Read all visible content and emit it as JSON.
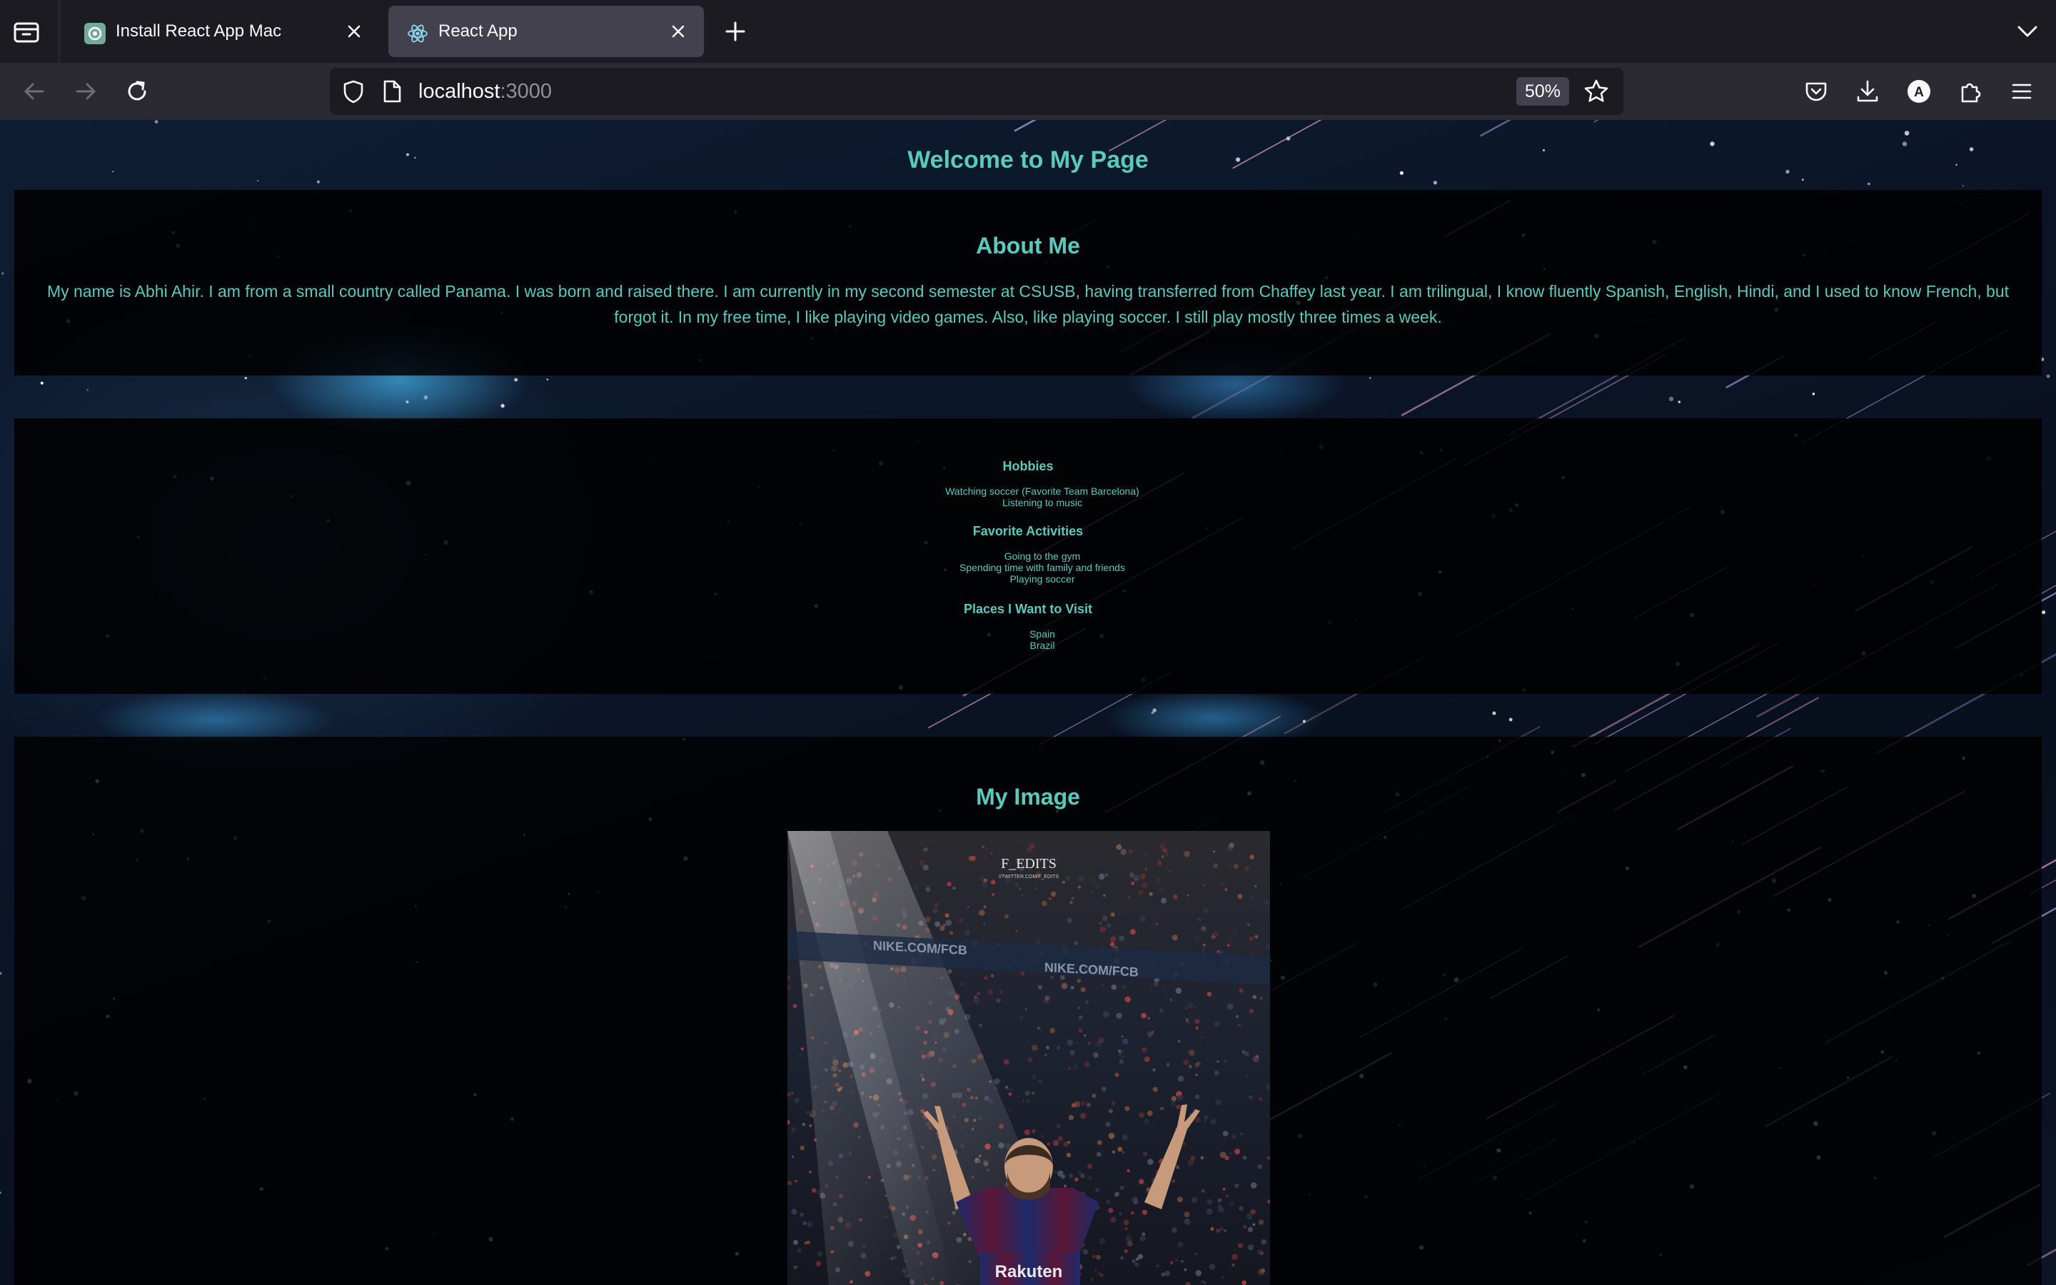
{
  "browser": {
    "tabs": [
      {
        "title": "Install React App Mac",
        "active": false,
        "favicon": "chatgpt-icon"
      },
      {
        "title": "React App",
        "active": true,
        "favicon": "react-icon"
      }
    ],
    "url_host": "localhost",
    "url_port": ":3000",
    "zoom": "50%"
  },
  "page": {
    "title": "Welcome to My Page",
    "about": {
      "heading": "About Me",
      "text": "My name is Abhi Ahir. I am from a small country called Panama. I was born and raised there. I am currently in my second semester at CSUSB, having transferred from Chaffey last year. I am trilingual, I know fluently Spanish, English, Hindi, and I used to know French, but forgot it. In my free time, I like playing video games. Also, like playing soccer. I still play mostly three times a week."
    },
    "hobbies": {
      "heading": "Hobbies",
      "items": [
        "Watching soccer (Favorite Team Barcelona)",
        "Listening to music"
      ]
    },
    "activities": {
      "heading": "Favorite Activities",
      "items": [
        "Going to the gym",
        "Spending time with family and friends",
        "Playing soccer"
      ]
    },
    "places": {
      "heading": "Places I Want to Visit",
      "items": [
        "Spain",
        "Brazil"
      ]
    },
    "image": {
      "heading": "My Image",
      "watermark": "F_EDITS",
      "watermark_sub": "//TWITTER.COM/F_EDITS",
      "banner_text": "NIKE.COM/FCB",
      "jersey_text": "Rakuten"
    }
  },
  "colors": {
    "accent": "#5cc9bd",
    "browser_bg": "#1c1b22",
    "toolbar_bg": "#2b2a33",
    "active_tab": "#42414d"
  }
}
